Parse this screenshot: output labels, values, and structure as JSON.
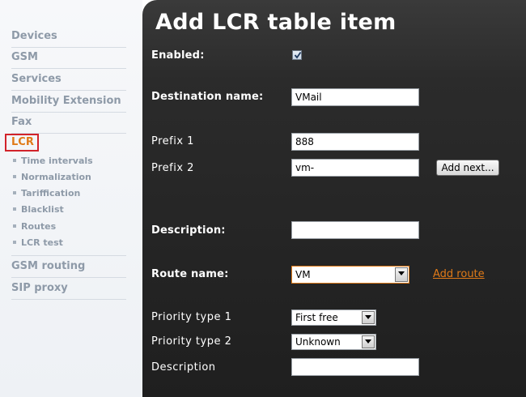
{
  "sidebar": {
    "items": [
      {
        "label": "Devices"
      },
      {
        "label": "GSM"
      },
      {
        "label": "Services"
      },
      {
        "label": "Mobility Extension"
      },
      {
        "label": "Fax"
      }
    ],
    "active": {
      "label": "LCR"
    },
    "subitems": [
      {
        "label": "Time intervals"
      },
      {
        "label": "Normalization"
      },
      {
        "label": "Tariffication"
      },
      {
        "label": "Blacklist"
      },
      {
        "label": "Routes"
      },
      {
        "label": "LCR test"
      }
    ],
    "bottom_items": [
      {
        "label": "GSM routing"
      },
      {
        "label": "SIP proxy"
      }
    ]
  },
  "page": {
    "title": "Add LCR table item"
  },
  "form": {
    "enabled": {
      "label": "Enabled:",
      "checked": true
    },
    "destination_name": {
      "label": "Destination name:",
      "value": "VMail"
    },
    "prefix1": {
      "label": "Prefix 1",
      "value": "888"
    },
    "prefix2": {
      "label": "Prefix 2",
      "value": "vm-"
    },
    "add_next_label": "Add next...",
    "description": {
      "label": "Description:",
      "value": ""
    },
    "route_name": {
      "label": "Route name:",
      "value": "VM"
    },
    "add_route_label": "Add route",
    "priority_type1": {
      "label": "Priority type 1",
      "value": "First free"
    },
    "priority_type2": {
      "label": "Priority type 2",
      "value": "Unknown"
    },
    "description2": {
      "label": "Description",
      "value": ""
    }
  },
  "colors": {
    "accent": "#e07a18",
    "highlight_border": "#d2232a",
    "panel_bg": "#2b2b2b",
    "sidebar_text": "#8e9aa8"
  }
}
